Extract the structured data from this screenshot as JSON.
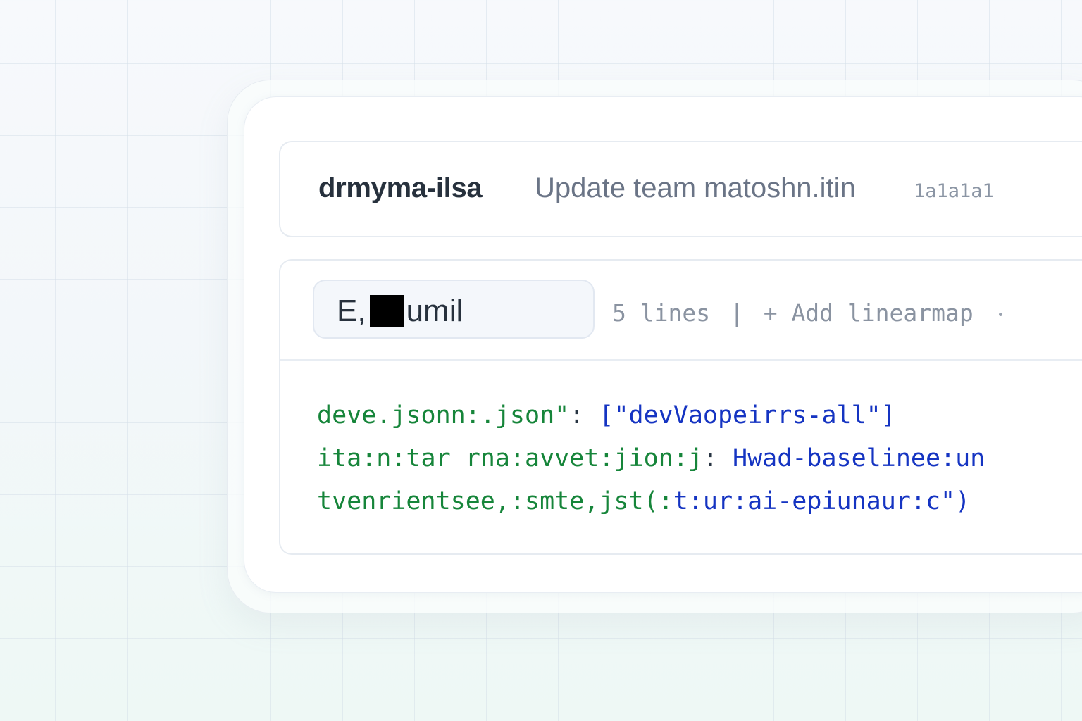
{
  "commit": {
    "repo_name": "drmyma-ilsa",
    "message": "Update team matoshn.itin",
    "hash": "1a1a1a1"
  },
  "file": {
    "name_prefix": "E,",
    "name_suffix": "umil",
    "lines_count": "5 lines",
    "separator": "|",
    "add_action": "+ Add linearmap"
  },
  "code": {
    "lines": [
      {
        "key": "deve.jsonn:.json\"",
        "separator": ":",
        "value": "[\"devVaopeirrs-all\"]"
      },
      {
        "key": "ita:n:tar rna:avvet:jion:j",
        "separator": ":",
        "value": "Hwad-baselinee:un"
      },
      {
        "key": "tvenrientsee,:smte,jst(:",
        "separator": "",
        "value": "t:ur:ai-epiunaur:c\")"
      }
    ]
  },
  "colors": {
    "code_key": "#16853a",
    "code_value": "#1534c2",
    "text_primary": "#27313d",
    "text_secondary": "#6a7486",
    "text_muted": "#8a93a1",
    "chip_background": "#f4f7fb"
  },
  "icons": {
    "redaction": "redaction-block",
    "more": "more-dot-icon"
  }
}
